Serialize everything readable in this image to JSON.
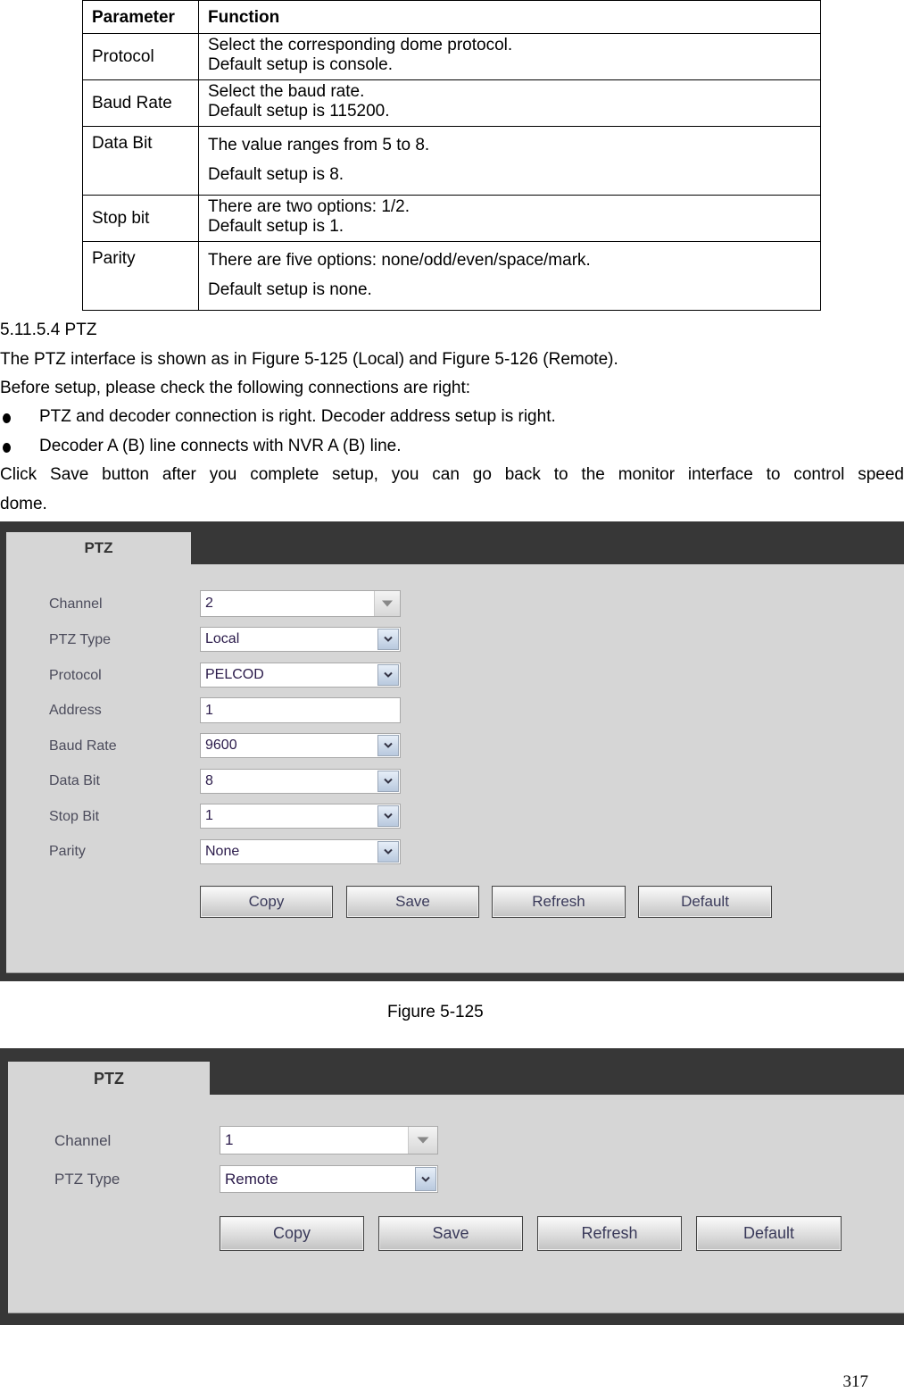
{
  "param_table": {
    "headers": [
      "Parameter",
      "Function"
    ],
    "rows": [
      {
        "param": "Protocol",
        "lines": [
          "Select the corresponding dome protocol.",
          "Default setup is console."
        ]
      },
      {
        "param": "Baud Rate",
        "lines": [
          "Select the baud rate.",
          "Default setup is 115200."
        ]
      },
      {
        "param": "Data Bit",
        "lines": [
          "The value ranges from 5 to 8.",
          "Default setup is 8."
        ]
      },
      {
        "param": "Stop bit",
        "lines": [
          "There are two options: 1/2.",
          "Default setup is 1."
        ]
      },
      {
        "param": "Parity",
        "lines": [
          "There are five options: none/odd/even/space/mark.",
          "Default setup is none."
        ]
      }
    ]
  },
  "section": {
    "heading": "5.11.5.4  PTZ",
    "intro": "The PTZ interface is shown as in Figure 5-125 (Local) and Figure 5-126 (Remote).",
    "check": "Before setup, please check the following connections are right:",
    "bullets": [
      "PTZ and decoder connection is right. Decoder address setup is right.",
      "Decoder A (B) line connects with NVR A (B) line."
    ],
    "note_line1": "Click Save button after you complete setup, you can go back to the monitor interface to control speed",
    "note_line2": "dome."
  },
  "figure_local": {
    "tab": "PTZ",
    "fields": [
      {
        "label": "Channel",
        "value": "2",
        "type": "select-gray"
      },
      {
        "label": "PTZ Type",
        "value": "Local",
        "type": "select"
      },
      {
        "label": "Protocol",
        "value": "PELCOD",
        "type": "select"
      },
      {
        "label": "Address",
        "value": "1",
        "type": "input"
      },
      {
        "label": "Baud Rate",
        "value": "9600",
        "type": "select"
      },
      {
        "label": "Data Bit",
        "value": "8",
        "type": "select"
      },
      {
        "label": "Stop Bit",
        "value": "1",
        "type": "select"
      },
      {
        "label": "Parity",
        "value": "None",
        "type": "select"
      }
    ],
    "buttons": [
      "Copy",
      "Save",
      "Refresh",
      "Default"
    ],
    "caption": "Figure 5-125"
  },
  "figure_remote": {
    "tab": "PTZ",
    "fields": [
      {
        "label": "Channel",
        "value": "1",
        "type": "select-gray"
      },
      {
        "label": "PTZ Type",
        "value": "Remote",
        "type": "select"
      }
    ],
    "buttons": [
      "Copy",
      "Save",
      "Refresh",
      "Default"
    ]
  },
  "page_number": "317"
}
